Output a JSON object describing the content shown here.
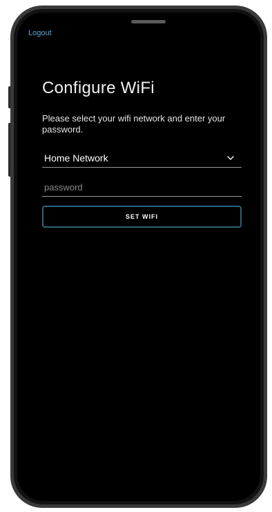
{
  "header": {
    "logout_label": "Logout"
  },
  "main": {
    "title": "Configure WiFi",
    "subtitle": "Please select your wifi network and enter your password.",
    "network_select": {
      "selected": "Home Network"
    },
    "password_field": {
      "value": "",
      "placeholder": "password"
    },
    "set_wifi_label": "SET WIFI"
  },
  "colors": {
    "accent_link": "#5aa7d6",
    "button_border": "#2c6478",
    "background": "#000000"
  },
  "icons": {
    "select_chevron": "chevron-down-icon"
  }
}
